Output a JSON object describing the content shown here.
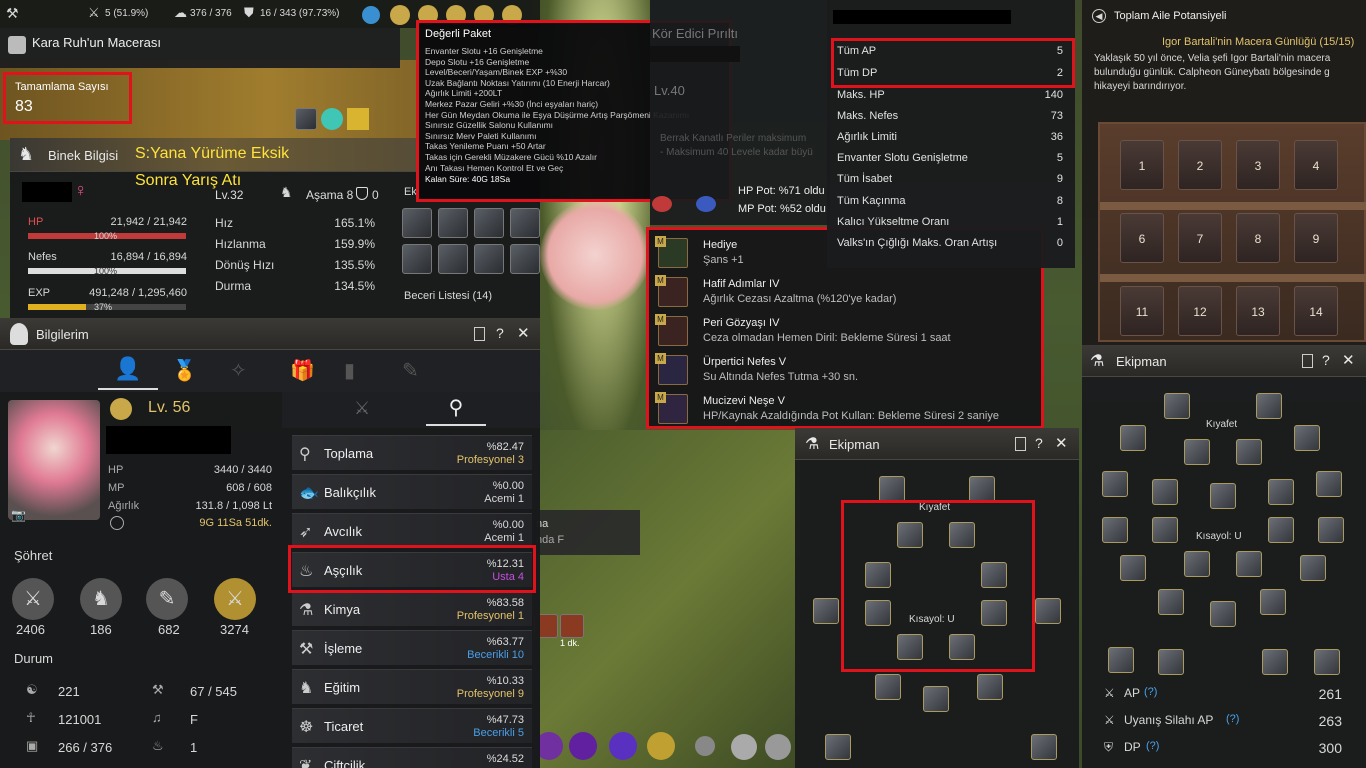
{
  "topbar": {
    "s1": "5 (51.9%)",
    "s2": "376 / 376",
    "s3": "16 / 343 (97.73%)"
  },
  "quest": {
    "title": "Kara Ruh'un Macerası",
    "completion_label": "Tamamlama Sayısı",
    "completion_value": "83"
  },
  "mount": {
    "title": "Binek Bilgisi",
    "annotation1": "S:Yana Yürüme Eksik",
    "annotation2": "Sonra Yarış Atı",
    "level": "Lv.32",
    "tier": "Aşama 8",
    "tier_extra": "0",
    "hp_label": "HP",
    "hp_value": "21,942 / 21,942",
    "hp_pct": "100%",
    "stamina_label": "Nefes",
    "stamina_value": "16,894 / 16,894",
    "stamina_pct": "100%",
    "exp_label": "EXP",
    "exp_value": "491,248 / 1,295,460",
    "exp_pct": "37%",
    "stats": [
      {
        "k": "Hız",
        "v": "165.1%"
      },
      {
        "k": "Hızlanma",
        "v": "159.9%"
      },
      {
        "k": "Dönüş Hızı",
        "v": "135.5%"
      },
      {
        "k": "Durma",
        "v": "134.5%"
      }
    ],
    "skills_label": "Beceri Listesi (14)",
    "eq_label": "Ek"
  },
  "pack": {
    "title": "Değerli Paket",
    "lines": [
      "Envanter Slotu +16 Genişletme",
      "Depo Slotu +16 Genişletme",
      "Level/Beceri/Yaşam/Binek EXP +%30",
      "Uzak Bağlantı Noktası Yatırımı (10 Enerji Harcar)",
      "Ağırlık Limiti +200LT",
      "Merkez Pazar Geliri +%30 (İnci eşyaları hariç)",
      "Her Gün Meydan Okuma ile Eşya Düşürme Artış Parşömeni Kazanımı",
      "Sınırsız Güzellik Salonu Kullanımı",
      "Sınırsız Merv Paleti Kullanımı",
      "Takas Yenileme Puanı +50 Artar",
      "Takas için Gerekli Müzakere Gücü %10 Azalır",
      "Anı Takası Hemen Kontrol Et ve Geç"
    ],
    "remaining": "Kalan Süre: 40G 18Sa"
  },
  "pet": {
    "name": "Kör Edici Pırıltı",
    "level": "Lv.40",
    "desc1": "Berrak Kanatlı Periler maksimum",
    "desc2": "- Maksimum 40 Levele kadar büyü",
    "hp_pot": "HP Pot: %71 oldu",
    "mp_pot": "MP Pot: %52 oldu",
    "frag1": "na",
    "frag2": "nda F",
    "frag3": "1 dk."
  },
  "skills": [
    {
      "name": "Hediye",
      "desc": "Şans +1"
    },
    {
      "name": "Hafif Adımlar IV",
      "desc": "Ağırlık Cezası Azaltma (%120'ye kadar)"
    },
    {
      "name": "Peri Gözyaşı IV",
      "desc": "Ceza olmadan Hemen Diril: Bekleme Süresi 1 saat"
    },
    {
      "name": "Ürpertici Nefes V",
      "desc": "Su Altında Nefes Tutma +30 sn."
    },
    {
      "name": "Mucizevi Neşe V",
      "desc": "HP/Kaynak Azaldığında Pot Kullan: Bekleme Süresi 2 saniye"
    }
  ],
  "stats_panel": {
    "rows": [
      {
        "k": "Tüm AP",
        "v": "5"
      },
      {
        "k": "Tüm DP",
        "v": "2"
      },
      {
        "k": "Maks. HP",
        "v": "140"
      },
      {
        "k": "Maks. Nefes",
        "v": "73"
      },
      {
        "k": "Ağırlık Limiti",
        "v": "36"
      },
      {
        "k": "Envanter Slotu Genişletme",
        "v": "5"
      },
      {
        "k": "Tüm İsabet",
        "v": "9"
      },
      {
        "k": "Tüm Kaçınma",
        "v": "8"
      },
      {
        "k": "Kalıcı Yükseltme Oranı",
        "v": "1"
      },
      {
        "k": "Valks'ın Çığlığı Maks. Oran Artışı",
        "v": "0"
      }
    ]
  },
  "family": {
    "title": "Toplam Aile Potansiyeli",
    "journal": "Igor Bartali'nin Macera Günlüğü (15/15)",
    "text1": "Yaklaşık 50 yıl önce, Velia şefi Igor Bartali'nin macera",
    "text2": "bulunduğu günlük. Calpheon Güneybatı bölgesinde g",
    "text3": "hikayeyi barındırıyor.",
    "books": [
      "1",
      "2",
      "3",
      "4",
      "6",
      "7",
      "8",
      "9",
      "11",
      "12",
      "13",
      "14"
    ]
  },
  "myinfo": {
    "title": "Bilgilerim",
    "level": "Lv. 56",
    "hp_label": "HP",
    "hp_value": "3440 / 3440",
    "mp_label": "MP",
    "mp_value": "608 / 608",
    "weight_label": "Ağırlık",
    "weight_value": "131.8 / 1,098 Lt",
    "time_value": "9G 11Sa 51dk.",
    "fame_label": "Şöhret",
    "fame": [
      "2406",
      "186",
      "682",
      "3274"
    ],
    "status_label": "Durum",
    "status": [
      {
        "a": "221",
        "b": "67 / 545"
      },
      {
        "a": "121001",
        "b": "F"
      },
      {
        "a": "266 / 376",
        "b": "1"
      }
    ]
  },
  "life": [
    {
      "name": "Toplama",
      "pct": "%82.47",
      "lvl": "Profesyonel 3",
      "color": "#e2c36b"
    },
    {
      "name": "Balıkçılık",
      "pct": "%0.00",
      "lvl": "Acemi 1",
      "color": "#d8d8d8"
    },
    {
      "name": "Avcılık",
      "pct": "%0.00",
      "lvl": "Acemi 1",
      "color": "#d8d8d8"
    },
    {
      "name": "Aşçılık",
      "pct": "%12.31",
      "lvl": "Usta 4",
      "color": "#c64fe0"
    },
    {
      "name": "Kimya",
      "pct": "%83.58",
      "lvl": "Profesyonel 1",
      "color": "#e2c36b"
    },
    {
      "name": "İşleme",
      "pct": "%63.77",
      "lvl": "Becerikli 10",
      "color": "#4aa0e8"
    },
    {
      "name": "Eğitim",
      "pct": "%10.33",
      "lvl": "Profesyonel 9",
      "color": "#e2c36b"
    },
    {
      "name": "Ticaret",
      "pct": "%47.73",
      "lvl": "Becerikli 5",
      "color": "#4aa0e8"
    },
    {
      "name": "Çiftçilik",
      "pct": "%24.52",
      "lvl": "",
      "color": "#d8d8d8"
    }
  ],
  "equip_mid": {
    "title": "Ekipman",
    "costume": "Kıyafet",
    "shortcut": "Kısayol: U"
  },
  "equip_right": {
    "title": "Ekipman",
    "costume": "Kıyafet",
    "shortcut": "Kısayol: U",
    "ap_label": "AP",
    "ap": "261",
    "awaken_label": "Uyanış Silahı AP",
    "awaken": "263",
    "dp_label": "DP",
    "dp": "300"
  },
  "colors": {
    "highlight": "#e0121c",
    "gold": "#e2c36b",
    "master": "#c64fe0",
    "skilled": "#4aa0e8"
  }
}
